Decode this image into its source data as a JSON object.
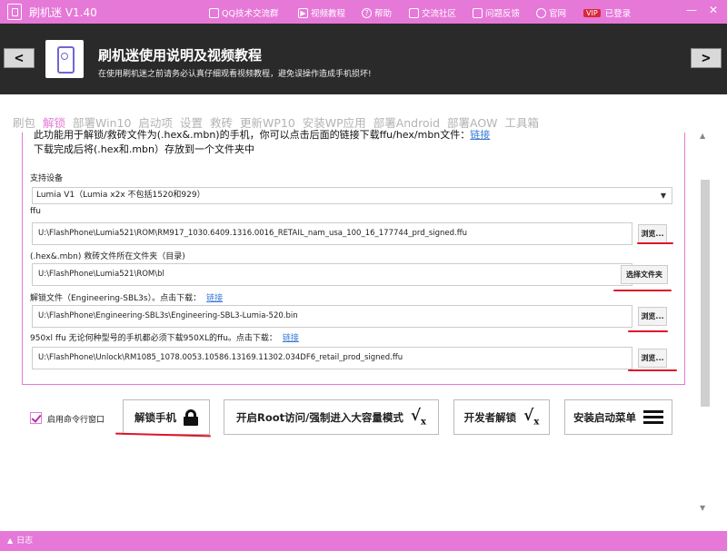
{
  "titlebar": {
    "title": "刷机迷 V1.40",
    "links": [
      {
        "icon": "qq-icon",
        "label": "QQ技术交流群"
      },
      {
        "icon": "video-icon",
        "label": "视频教程"
      },
      {
        "icon": "help-icon",
        "label": "帮助"
      },
      {
        "icon": "community-icon",
        "label": "交流社区"
      },
      {
        "icon": "feedback-icon",
        "label": "问题反馈"
      },
      {
        "icon": "globe-icon",
        "label": "官网"
      },
      {
        "icon": "vip-badge",
        "badge": "VIP",
        "label": "已登录"
      }
    ],
    "controls": {
      "minimize": "—",
      "close": "✕"
    }
  },
  "banner": {
    "prev": "<",
    "next": ">",
    "title": "刷机迷使用说明及视频教程",
    "subtitle": "在使用刷机迷之前请务必认真仔细观看视频教程，避免误操作造成手机损坏!"
  },
  "tabs": [
    "刷包",
    "解锁",
    "部署Win10",
    "启动项",
    "设置",
    "救砖",
    "更新WP10",
    "安装WP应用",
    "部署Android",
    "部署AOW",
    "工具箱"
  ],
  "active_tab": "解锁",
  "panel": {
    "intro_line1": "此功能用于解锁/救砖文件为(.hex&.mbn)的手机，你可以点击后面的链接下载ffu/hex/mbn文件：",
    "intro_link": "链接",
    "intro_line2": "下载完成后将(.hex和.mbn）存放到一个文件夹中",
    "device_label": "支持设备",
    "device_value": "Lumia V1（Lumia x2x 不包括1520和929）",
    "ffu_label": "ffu",
    "ffu_path": "U:\\FlashPhone\\Lumia521\\ROM\\RM917_1030.6409.1316.0016_RETAIL_nam_usa_100_16_177744_prd_signed.ffu",
    "ffu_button": "浏览...",
    "hex_label": "(.hex&.mbn) 救砖文件所在文件夹（目录)",
    "hex_path": "U:\\FlashPhone\\Lumia521\\ROM\\bl",
    "hex_button": "选择文件夹",
    "unlock_label": "解锁文件（Engineering-SBL3s）。点击下载：",
    "unlock_link": "链接",
    "unlock_path": "U:\\FlashPhone\\Engineering-SBL3s\\Engineering-SBL3-Lumia-520.bin",
    "unlock_button": "浏览...",
    "xl_label": "950xl ffu    无论何种型号的手机都必须下载950XL的ffu。点击下载：",
    "xl_link": "链接",
    "xl_path": "U:\\FlashPhone\\Unlock\\RM1085_1078.0053.10586.13169.11302.034DF6_retail_prod_signed.ffu",
    "xl_button": "浏览..."
  },
  "actions": {
    "checkbox_label": "启用命令行窗口",
    "checkbox_checked": true,
    "unlock_phone": "解锁手机",
    "root_access": "开启Root访问/强制进入大容量模式",
    "dev_unlock": "开发者解锁",
    "install_boot": "安装启动菜单"
  },
  "status": {
    "label": "日志"
  },
  "colors": {
    "accent": "#e678d8",
    "banner": "#2a2a2a",
    "link": "#3a7bd5",
    "annotation": "#e0142a"
  }
}
